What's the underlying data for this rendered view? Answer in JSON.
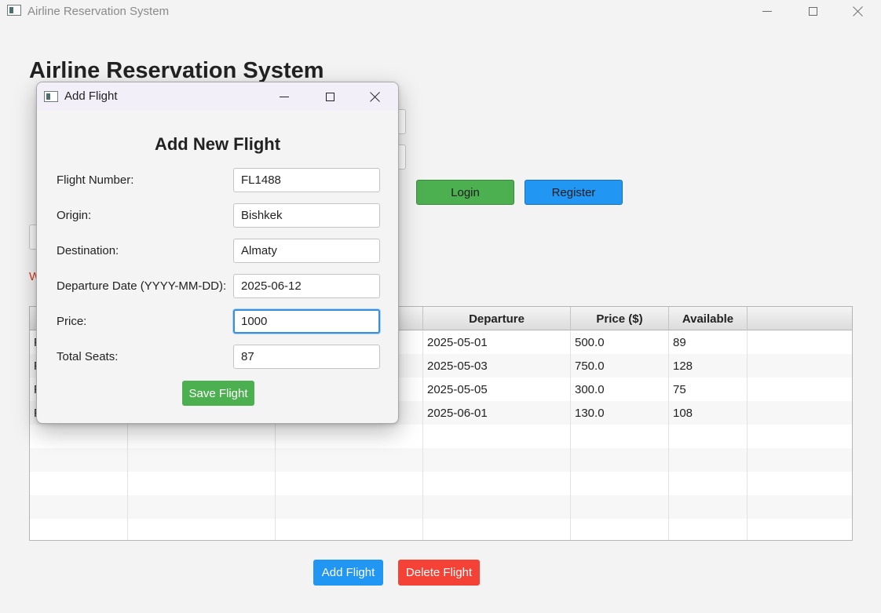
{
  "window": {
    "title": "Airline Reservation System",
    "icon": "app-window-icon"
  },
  "main": {
    "heading": "Airline Reservation System",
    "login_label": "Login",
    "register_label": "Register",
    "welcome_fragment": "W",
    "add_flight_label": "Add Flight",
    "delete_flight_label": "Delete Flight"
  },
  "table": {
    "columns": [
      "",
      "",
      "",
      "Departure",
      "Price ($)",
      "Available",
      ""
    ],
    "rows": [
      [
        "F",
        "",
        "",
        "2025-05-01",
        "500.0",
        "89",
        ""
      ],
      [
        "F",
        "",
        "",
        "2025-05-03",
        "750.0",
        "128",
        ""
      ],
      [
        "F",
        "",
        "",
        "2025-05-05",
        "300.0",
        "75",
        ""
      ],
      [
        "F",
        "",
        "",
        "2025-06-01",
        "130.0",
        "108",
        ""
      ]
    ]
  },
  "dialog": {
    "title": "Add Flight",
    "heading": "Add New Flight",
    "fields": [
      {
        "label": "Flight Number:",
        "value": "FL1488"
      },
      {
        "label": "Origin:",
        "value": "Bishkek"
      },
      {
        "label": "Destination:",
        "value": "Almaty"
      },
      {
        "label": "Departure Date (YYYY-MM-DD):",
        "value": "2025-06-12"
      },
      {
        "label": "Price:",
        "value": "1000"
      },
      {
        "label": "Total Seats:",
        "value": "87"
      }
    ],
    "save_label": "Save Flight"
  },
  "colors": {
    "green": "#4caf50",
    "blue": "#2196f3",
    "red": "#f44336",
    "focus": "#3a8fd9"
  }
}
